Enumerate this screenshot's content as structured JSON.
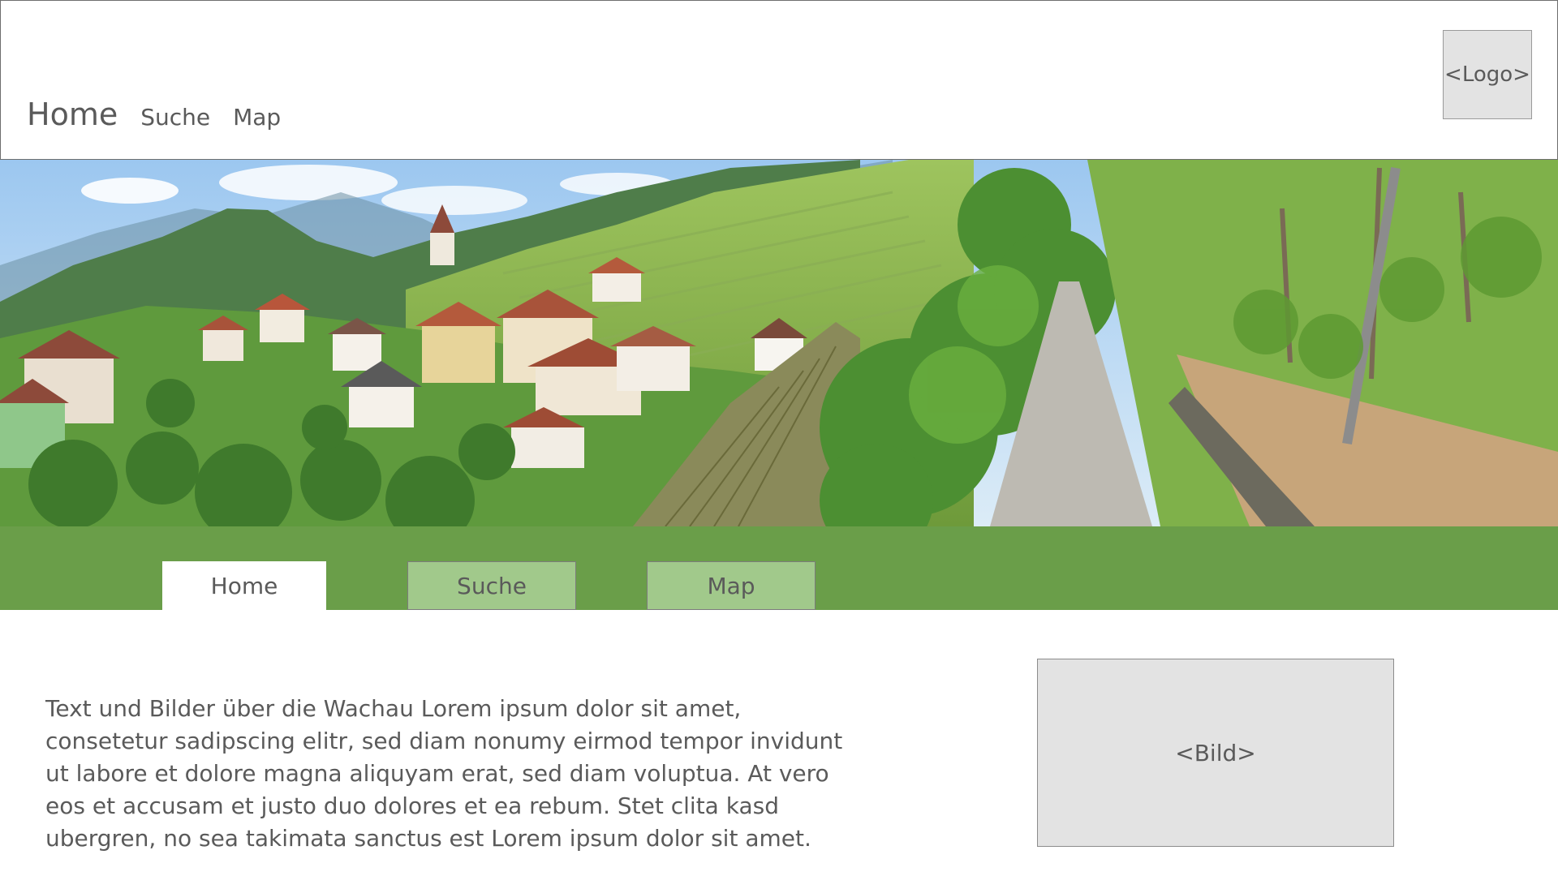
{
  "header": {
    "nav": [
      {
        "label": "Home"
      },
      {
        "label": "Suche"
      },
      {
        "label": "Map"
      }
    ],
    "logo_placeholder": "<Logo>"
  },
  "tabs": [
    {
      "label": "Home",
      "active": true
    },
    {
      "label": "Suche",
      "active": false
    },
    {
      "label": "Map",
      "active": false
    }
  ],
  "content": {
    "text": "Text und Bilder über die Wachau Lorem ipsum dolor sit amet, consetetur sadipscing elitr, sed diam nonumy eirmod tempor invidunt ut labore et dolore magna aliquyam erat, sed diam voluptua. At vero eos et accusam et justo duo dolores et ea rebum. Stet clita kasd ubergren, no sea takimata sanctus est Lorem ipsum dolor sit amet.",
    "image_placeholder": "<Bild>"
  },
  "colors": {
    "accent_green": "#6a9e49",
    "tab_inactive": "#a1c98b",
    "placeholder_gray": "#e3e3e3"
  }
}
